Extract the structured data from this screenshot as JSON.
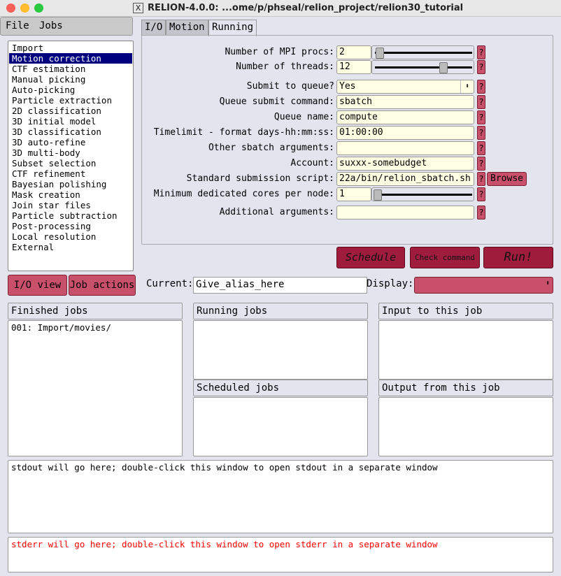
{
  "window": {
    "title": "RELION-4.0.0: ...ome/p/phseal/relion_project/relion30_tutorial"
  },
  "menu": {
    "file": "File",
    "jobs": "Jobs"
  },
  "job_types": [
    "Import",
    "Motion correction",
    "CTF estimation",
    "Manual picking",
    "Auto-picking",
    "Particle extraction",
    "2D classification",
    "3D initial model",
    "3D classification",
    "3D auto-refine",
    "3D multi-body",
    "Subset selection",
    "CTF refinement",
    "Bayesian polishing",
    "Mask creation",
    "Join star files",
    "Particle subtraction",
    "Post-processing",
    "Local resolution",
    "External"
  ],
  "selected_job_type": "Motion correction",
  "tabs": [
    "I/O",
    "Motion",
    "Running"
  ],
  "active_tab": "Running",
  "form": {
    "mpi": {
      "label": "Number of MPI procs:",
      "value": "2",
      "slider_fraction": 0.02
    },
    "threads": {
      "label": "Number of threads:",
      "value": "12",
      "slider_fraction": 0.72
    },
    "submit_queue": {
      "label": "Submit to queue?",
      "value": "Yes"
    },
    "queue_cmd": {
      "label": "Queue submit command:",
      "value": "sbatch"
    },
    "queue_name": {
      "label": "Queue name:",
      "value": "compute"
    },
    "timelimit": {
      "label": "Timelimit - format days-hh:mm:ss:",
      "value": "01:00:00"
    },
    "other_args": {
      "label": "Other sbatch arguments:",
      "value": ""
    },
    "account": {
      "label": "Account:",
      "value": "suxxx-somebudget"
    },
    "script": {
      "label": "Standard submission script:",
      "value": "22a/bin/relion_sbatch.sh",
      "browse": "Browse"
    },
    "min_cores": {
      "label": "Minimum dedicated cores per node:",
      "value": "1",
      "slider_fraction": 0.0
    },
    "additional": {
      "label": "Additional arguments:",
      "value": ""
    },
    "help": "?"
  },
  "actions": {
    "schedule": "Schedule",
    "check": "Check command",
    "run": "Run!"
  },
  "bar": {
    "io_view": "I/O view",
    "job_actions": "Job actions",
    "current_label": "Current:",
    "current_value": "Give_alias_here",
    "display_label": "Display:"
  },
  "panels": {
    "finished": "Finished jobs",
    "running": "Running jobs",
    "scheduled": "Scheduled jobs",
    "input": "Input to this job",
    "output": "Output from this job"
  },
  "finished_jobs": [
    "001: Import/movies/"
  ],
  "stdout": "stdout will go here; double-click this window to open stdout in a separate window",
  "stderr": "stderr will go here; double-click this window to open stderr in a separate window",
  "colors": {
    "accent": "#a01c3c",
    "help": "#c8506a",
    "selection": "#00007f",
    "stderr": "#ff0000"
  }
}
